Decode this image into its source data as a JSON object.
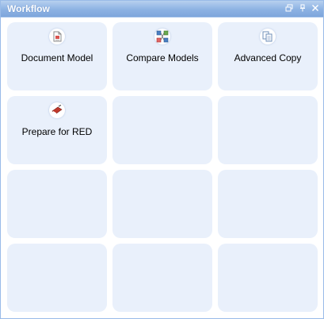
{
  "panel": {
    "title": "Workflow",
    "tools": [
      {
        "name": "restore-icon"
      },
      {
        "name": "pin-icon"
      },
      {
        "name": "close-icon"
      }
    ]
  },
  "tiles": [
    {
      "label": "Document Model",
      "icon": "document-icon"
    },
    {
      "label": "Compare Models",
      "icon": "compare-icon"
    },
    {
      "label": "Advanced Copy",
      "icon": "copy-icon"
    },
    {
      "label": "Prepare for RED",
      "icon": "prepare-red-icon"
    },
    {
      "label": "",
      "icon": ""
    },
    {
      "label": "",
      "icon": ""
    },
    {
      "label": "",
      "icon": ""
    },
    {
      "label": "",
      "icon": ""
    },
    {
      "label": "",
      "icon": ""
    },
    {
      "label": "",
      "icon": ""
    },
    {
      "label": "",
      "icon": ""
    },
    {
      "label": "",
      "icon": ""
    }
  ],
  "colors": {
    "title_bar": "#8db2e3",
    "tile_background": "#e9f0fb",
    "border": "#99bbe8"
  }
}
